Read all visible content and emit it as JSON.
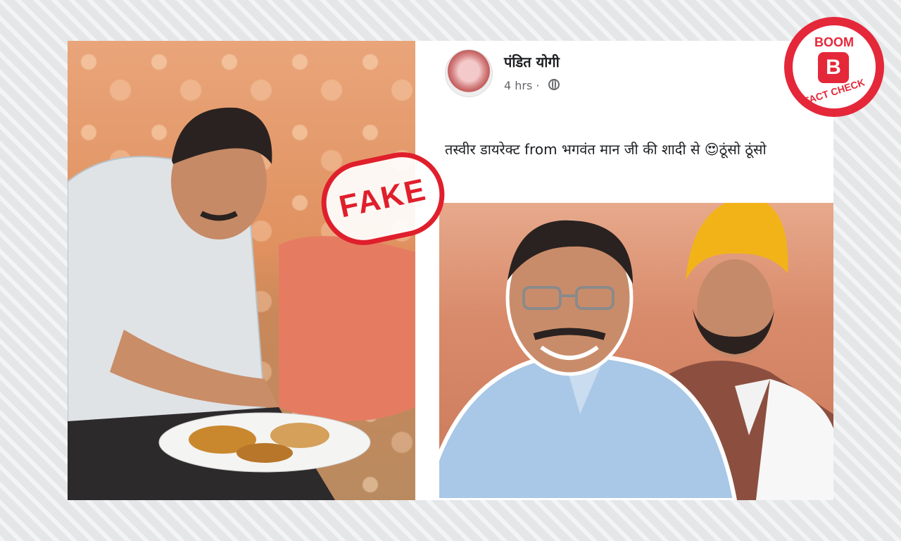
{
  "post": {
    "author": "पंडित योगी",
    "time": "4 hrs ·",
    "text": "तस्वीर डायरेक्ट from भगवंत मान जी की शादी से 😍ठूंसो ठूंसो"
  },
  "stamp": {
    "label": "FAKE"
  },
  "badge": {
    "top": "BOOM",
    "letter": "B",
    "bottom": "FACT CHECK"
  },
  "colors": {
    "stamp_red": "#e01f2c",
    "badge_red": "#e4283a",
    "turban_yellow": "#f2b319"
  }
}
